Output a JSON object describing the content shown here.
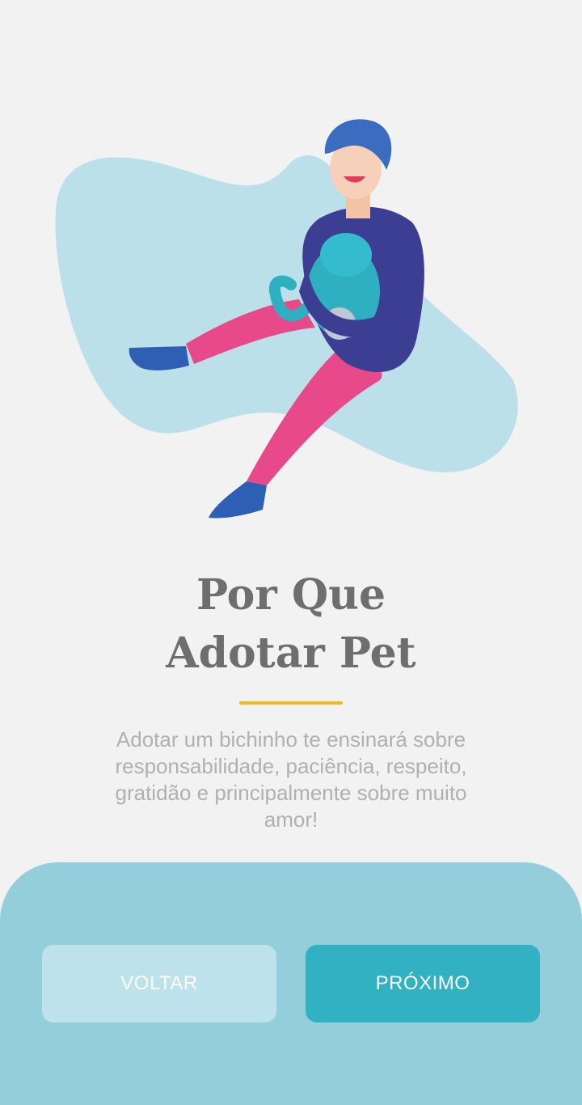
{
  "onboarding": {
    "title_line1": "Por Que",
    "title_line2": "Adotar Pet",
    "description": "Adotar um bichinho te ensinará sobre responsabilidade, paciência, respeito, gratidão e principalmente sobre muito amor!",
    "accent_color": "#f6b821"
  },
  "illustration": {
    "icon": "person-holding-cat-illustration",
    "blob_color": "#bce0ea"
  },
  "buttons": {
    "back_label": "VOLTAR",
    "next_label": "PRÓXIMO",
    "back_color": "#bde2eb",
    "next_color": "#31b1c2"
  },
  "panel": {
    "color": "#93ceda"
  }
}
